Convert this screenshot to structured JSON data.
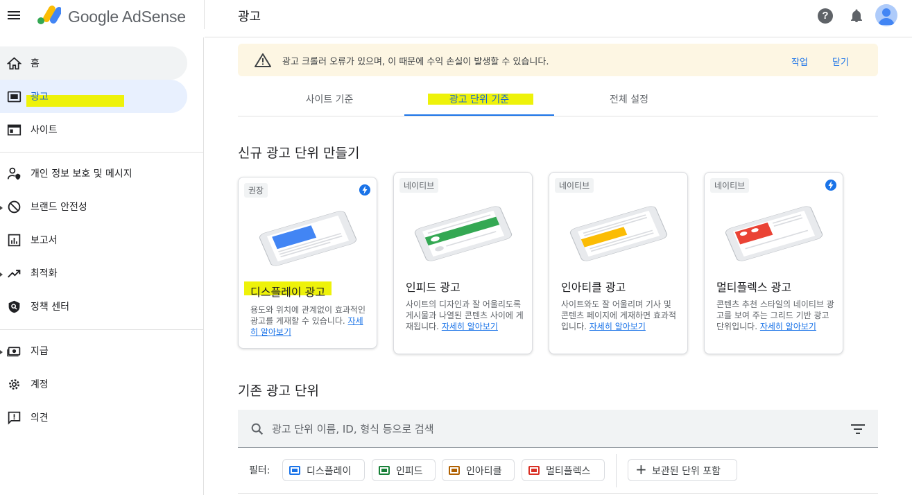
{
  "app": {
    "brand": "Google AdSense",
    "page_title": "광고"
  },
  "sidebar": {
    "items": [
      {
        "label": "홈",
        "icon": "home-icon"
      },
      {
        "label": "광고",
        "icon": "ads-icon"
      },
      {
        "label": "사이트",
        "icon": "sites-icon"
      },
      {
        "label": "개인 정보 보호 및 메시지",
        "icon": "privacy-icon"
      },
      {
        "label": "브랜드 안전성",
        "icon": "block-icon"
      },
      {
        "label": "보고서",
        "icon": "reports-icon"
      },
      {
        "label": "최적화",
        "icon": "trending-icon"
      },
      {
        "label": "정책 센터",
        "icon": "policy-icon"
      },
      {
        "label": "지급",
        "icon": "payments-icon"
      },
      {
        "label": "계정",
        "icon": "settings-icon"
      },
      {
        "label": "의견",
        "icon": "feedback-icon"
      }
    ]
  },
  "banner": {
    "message": "광고 크롤러 오류가 있으며, 이 때문에 수익 손실이 발생할 수 있습니다.",
    "action": "작업",
    "dismiss": "닫기"
  },
  "tabs": [
    {
      "label": "사이트 기준"
    },
    {
      "label": "광고 단위 기준"
    },
    {
      "label": "전체 설정"
    }
  ],
  "create_section": {
    "title": "신규 광고 단위 만들기"
  },
  "cards": [
    {
      "chip": "권장",
      "title": "디스플레이 광고",
      "desc": "용도와 위치에 관계없이 효과적인 광고를 게재할 수 있습니다.",
      "link": "자세히 알아보기",
      "accent": "#4285f4"
    },
    {
      "chip": "네이티브",
      "title": "인피드 광고",
      "desc": "사이트의 디자인과 잘 어울리도록 게시물과 나열된 콘텐츠 사이에 게재됩니다.",
      "link": "자세히 알아보기",
      "accent": "#34a853"
    },
    {
      "chip": "네이티브",
      "title": "인아티클 광고",
      "desc": "사이트와도 잘 어울리며 기사 및 콘텐츠 페이지에 게재하면 효과적입니다.",
      "link": "자세히 알아보기",
      "accent": "#fbbc04"
    },
    {
      "chip": "네이티브",
      "title": "멀티플렉스 광고",
      "desc": "콘텐츠 추천 스타일의 네이티브 광고를 보여 주는 그리드 기반 광고 단위입니다.",
      "link": "자세히 알아보기",
      "accent": "#ea4335"
    }
  ],
  "existing_section": {
    "title": "기존 광고 단위"
  },
  "search": {
    "placeholder": "광고 단위 이름, ID, 형식 등으로 검색"
  },
  "filters": {
    "label": "필터:",
    "chips": [
      {
        "label": "디스플레이",
        "color": "#1a73e8"
      },
      {
        "label": "인피드",
        "color": "#188038"
      },
      {
        "label": "인아티클",
        "color": "#b06000"
      },
      {
        "label": "멀티플렉스",
        "color": "#d93025"
      }
    ],
    "archived": "보관된 단위 포함"
  }
}
